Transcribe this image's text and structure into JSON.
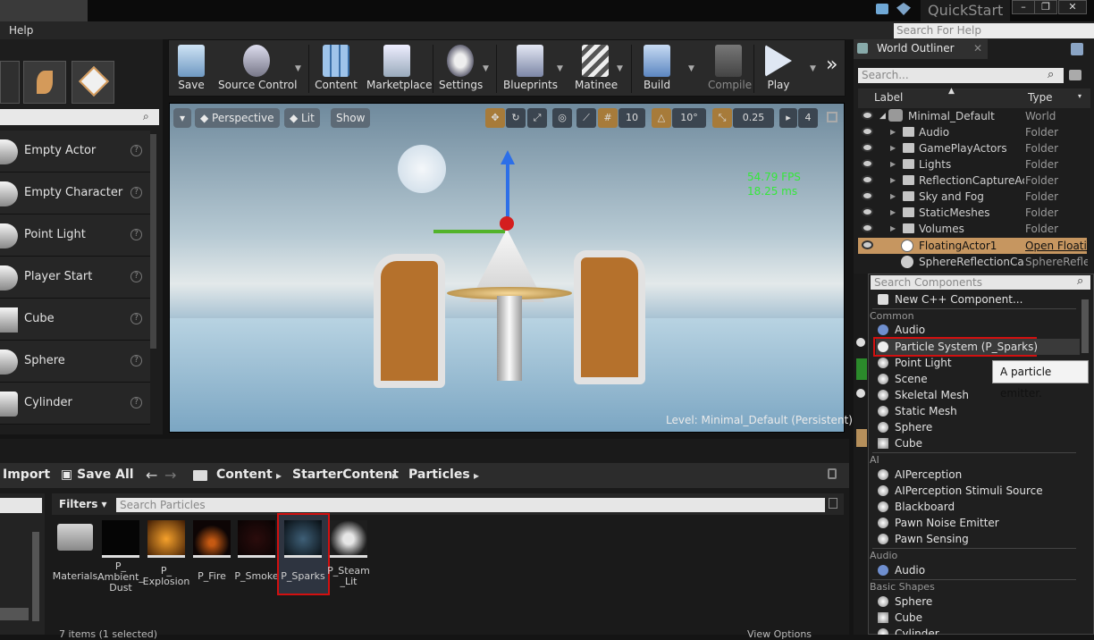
{
  "titlebar": {
    "quickstart": "QuickStart",
    "menu_help": "Help",
    "help_search_placeholder": "Search For Help"
  },
  "place": {
    "search_placeholder": "",
    "items": [
      {
        "label": "Empty Actor"
      },
      {
        "label": "Empty Character"
      },
      {
        "label": "Point Light"
      },
      {
        "label": "Player Start"
      },
      {
        "label": "Cube"
      },
      {
        "label": "Sphere"
      },
      {
        "label": "Cylinder"
      }
    ],
    "help_glyph": "?"
  },
  "toolbar": {
    "buttons": [
      {
        "label": "Save",
        "icon": "save-icon"
      },
      {
        "label": "Source Control",
        "icon": "source-control-icon"
      },
      {
        "label": "Content",
        "icon": "content-icon"
      },
      {
        "label": "Marketplace",
        "icon": "marketplace-icon"
      },
      {
        "label": "Settings",
        "icon": "settings-icon"
      },
      {
        "label": "Blueprints",
        "icon": "blueprints-icon"
      },
      {
        "label": "Matinee",
        "icon": "matinee-icon"
      },
      {
        "label": "Build",
        "icon": "build-icon"
      },
      {
        "label": "Compile",
        "icon": "compile-icon"
      },
      {
        "label": "Play",
        "icon": "play-icon"
      }
    ],
    "overflow": "»"
  },
  "viewport": {
    "perspective": "Perspective",
    "lit": "Lit",
    "show": "Show",
    "grid_snap": "10",
    "rot_snap": "10°",
    "scale_snap": "0.25",
    "cam_speed": "4",
    "fps": "54.79 FPS",
    "ms": "18.25 ms",
    "level_label": "Level:",
    "level_name": "Minimal_Default (Persistent)"
  },
  "content_browser": {
    "import": "Import",
    "save_all": "Save All",
    "breadcrumbs": [
      "Content",
      "StarterContent",
      "Particles"
    ],
    "filters": "Filters",
    "search_placeholder": "Search Particles",
    "assets": [
      {
        "label": "Materials",
        "kind": "folder"
      },
      {
        "label": "P_ Ambient_ Dust",
        "kind": "particle"
      },
      {
        "label": "P_ Explosion",
        "kind": "particle"
      },
      {
        "label": "P_Fire",
        "kind": "particle"
      },
      {
        "label": "P_Smoke",
        "kind": "particle"
      },
      {
        "label": "P_Sparks",
        "kind": "particle",
        "selected": true
      },
      {
        "label": "P_Steam _Lit",
        "kind": "particle"
      }
    ],
    "items_count": "7 items (1 selected)",
    "view_options": "View Options"
  },
  "outliner": {
    "tab_title": "World Outliner",
    "search_placeholder": "Search...",
    "col_label": "Label",
    "col_type": "Type",
    "rows": [
      {
        "name": "Minimal_Default",
        "type": "World"
      },
      {
        "name": "Audio",
        "type": "Folder"
      },
      {
        "name": "GamePlayActors",
        "type": "Folder"
      },
      {
        "name": "Lights",
        "type": "Folder"
      },
      {
        "name": "ReflectionCaptureActo",
        "type": "Folder"
      },
      {
        "name": "Sky and Fog",
        "type": "Folder"
      },
      {
        "name": "StaticMeshes",
        "type": "Folder"
      },
      {
        "name": "Volumes",
        "type": "Folder"
      },
      {
        "name": "FloatingActor1",
        "type": "Open Floatin"
      },
      {
        "name": "SphereReflectionCapti",
        "type": "SphereReflec"
      }
    ]
  },
  "components": {
    "search_placeholder": "Search Components",
    "new_cpp": "New C++ Component...",
    "categories": {
      "common": "Common",
      "ai": "AI",
      "audio": "Audio",
      "basic_shapes": "Basic Shapes"
    },
    "common_items": [
      "Audio",
      "Particle System  (P_Sparks)",
      "Point Light",
      "Scene",
      "Skeletal Mesh",
      "Static Mesh",
      "Sphere",
      "Cube"
    ],
    "ai_items": [
      "AIPerception",
      "AIPerception Stimuli Source",
      "Blackboard",
      "Pawn Noise Emitter",
      "Pawn Sensing"
    ],
    "audio_items": [
      "Audio"
    ],
    "basic_items": [
      "Sphere",
      "Cube",
      "Cylinder"
    ],
    "tooltip": "A particle emitter."
  }
}
